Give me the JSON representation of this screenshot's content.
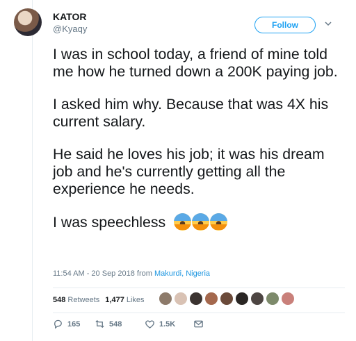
{
  "user": {
    "name": "KATOR",
    "handle": "@Kyaqy"
  },
  "follow_label": "Follow",
  "tweet": {
    "p1": "I was in school today, a friend of mine told me how he turned down a 200K paying job.",
    "p2": "I asked him why. Because that was 4X his current salary.",
    "p3": "He said he loves his job; it was his dream job and he's currently getting all the experience he needs.",
    "p4": "I was speechless"
  },
  "meta": {
    "time": "11:54 AM - 20 Sep 2018 from ",
    "location": "Makurdi, Nigeria"
  },
  "stats": {
    "retweets_count": "548",
    "retweets_label": "Retweets",
    "likes_count": "1,477",
    "likes_label": "Likes"
  },
  "actions": {
    "replies": "165",
    "retweets": "548",
    "likes": "1.5K"
  },
  "colors": {
    "accent": "#1da1f2",
    "link": "#1b95e0",
    "muted": "#657786"
  },
  "icons": [
    "chevron-down-icon",
    "reply-icon",
    "retweet-icon",
    "heart-icon",
    "message-icon",
    "screaming-face-emoji"
  ]
}
